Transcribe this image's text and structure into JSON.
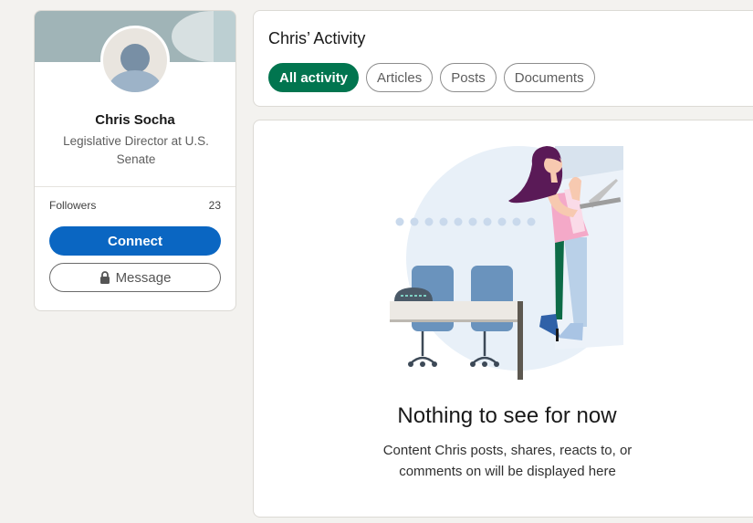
{
  "profile": {
    "name": "Chris Socha",
    "headline": "Legislative Director at U.S. Senate",
    "followers_label": "Followers",
    "followers_count": "23",
    "connect_label": "Connect",
    "message_label": "Message"
  },
  "activity": {
    "title": "Chris’ Activity",
    "filters": [
      {
        "label": "All activity",
        "active": true
      },
      {
        "label": "Articles",
        "active": false
      },
      {
        "label": "Posts",
        "active": false
      },
      {
        "label": "Documents",
        "active": false
      }
    ]
  },
  "empty_state": {
    "title": "Nothing to see for now",
    "description": "Content Chris posts, shares, reacts to, or comments on will be displayed here"
  },
  "colors": {
    "primary_blue": "#0a66c2",
    "active_green": "#01754f",
    "background": "#f3f2ef"
  },
  "icons": {
    "message_button": "lock-icon"
  }
}
